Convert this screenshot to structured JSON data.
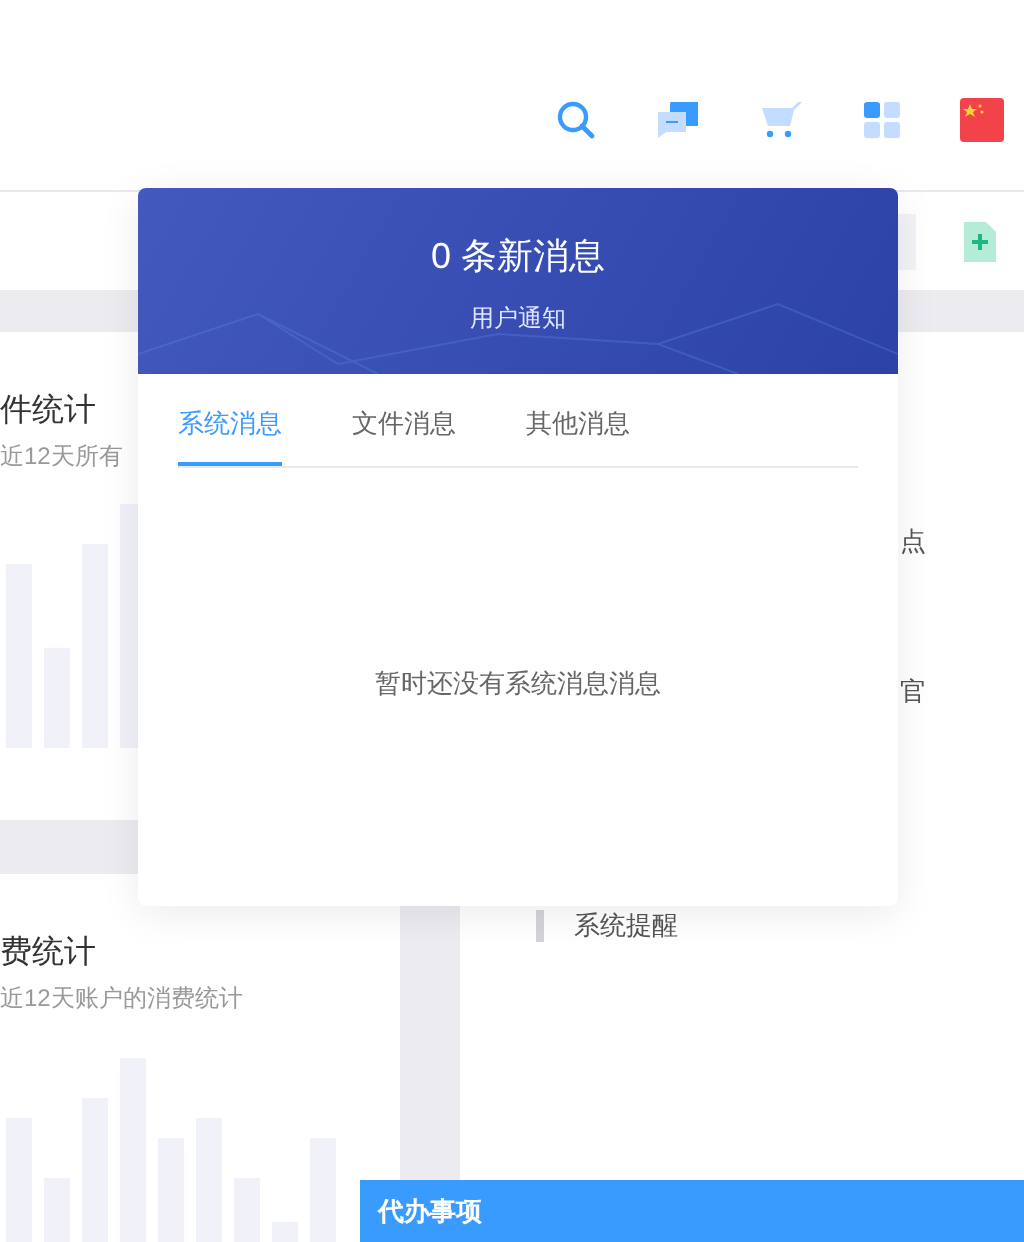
{
  "left_cards": [
    {
      "title": "件统计",
      "subtitle": "近12天所有"
    },
    {
      "title": "费统计",
      "subtitle": "近12天账户的消费统计"
    }
  ],
  "right_card": {
    "items": [
      {
        "text": "点"
      },
      {
        "text": "官"
      }
    ],
    "reminder": "系统提醒"
  },
  "popup": {
    "title": "0 条新消息",
    "subtitle": "用户通知",
    "tabs": [
      {
        "label": "系统消息",
        "selected": true
      },
      {
        "label": "文件消息",
        "selected": false
      },
      {
        "label": "其他消息",
        "selected": false
      }
    ],
    "empty_text": "暂时还没有系统消息消息"
  },
  "todo_bar": {
    "title": "代办事项"
  }
}
